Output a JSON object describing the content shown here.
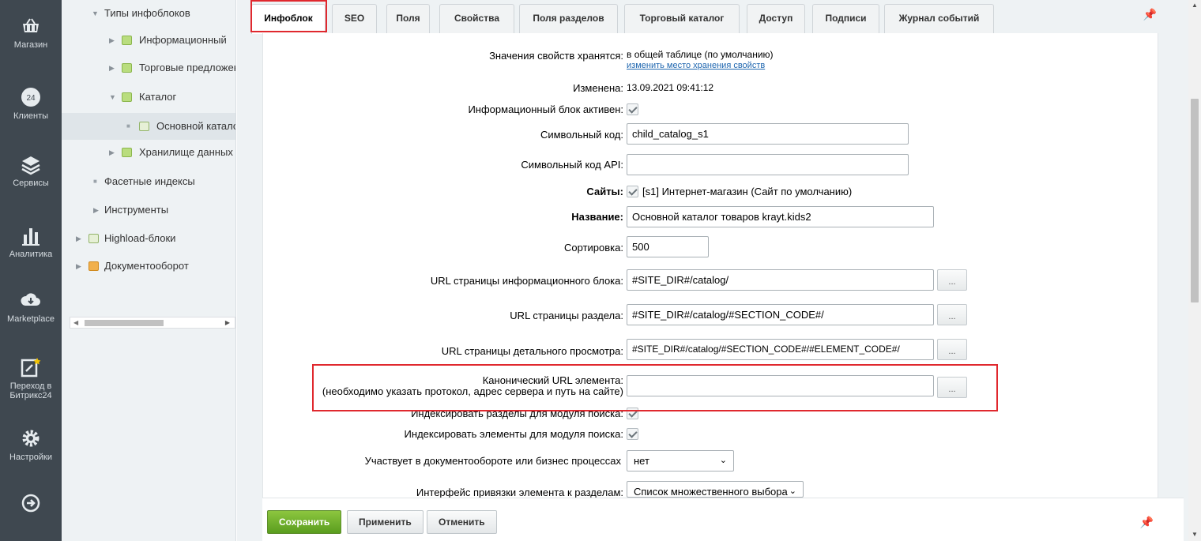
{
  "leftnav": {
    "items": [
      {
        "label": "Магазин",
        "icon": "basket-icon"
      },
      {
        "label": "Клиенты",
        "icon": "crm-24-icon"
      },
      {
        "label": "Сервисы",
        "icon": "layers-icon"
      },
      {
        "label": "Аналитика",
        "icon": "bar-chart-icon"
      },
      {
        "label": "Marketplace",
        "icon": "cloud-download-icon"
      },
      {
        "label": "Переход в Битрикс24",
        "icon": "star-edit-icon"
      },
      {
        "label": "Настройки",
        "icon": "gear-icon"
      }
    ],
    "bottom_icon": "arrow-circle-icon"
  },
  "tree": {
    "items": [
      {
        "label": "Типы инфоблоков",
        "expanded": true
      },
      {
        "label": "Информационный"
      },
      {
        "label": "Торговые предложения"
      },
      {
        "label": "Каталог",
        "expanded": true
      },
      {
        "label": "Основной каталог"
      },
      {
        "label": "Хранилище данных"
      },
      {
        "label": "Фасетные индексы"
      },
      {
        "label": "Инструменты"
      },
      {
        "label": "Highload-блоки"
      },
      {
        "label": "Документооборот"
      }
    ]
  },
  "tabs": [
    "Инфоблок",
    "SEO",
    "Поля",
    "Свойства",
    "Поля разделов",
    "Торговый каталог",
    "Доступ",
    "Подписи",
    "Журнал событий"
  ],
  "form": {
    "storage_label": "Значения свойств хранятся:",
    "storage_value": "в общей таблице (по умолчанию)",
    "storage_link": "изменить место хранения свойств",
    "modified_label": "Изменена:",
    "modified_value": "13.09.2021 09:41:12",
    "active_label": "Информационный блок активен:",
    "code_label": "Символьный код:",
    "code_value": "child_catalog_s1",
    "api_code_label": "Символьный код API:",
    "api_code_value": "",
    "sites_label": "Сайты:",
    "sites_value": "[s1] Интернет-магазин (Сайт по умолчанию)",
    "name_label": "Название:",
    "name_value": "Основной каталог товаров krayt.kids2",
    "sort_label": "Сортировка:",
    "sort_value": "500",
    "list_url_label": "URL страницы информационного блока:",
    "list_url_value": "#SITE_DIR#/catalog/",
    "section_url_label": "URL страницы раздела:",
    "section_url_value": "#SITE_DIR#/catalog/#SECTION_CODE#/",
    "detail_url_label": "URL страницы детального просмотра:",
    "detail_url_value": "#SITE_DIR#/catalog/#SECTION_CODE#/#ELEMENT_CODE#/",
    "canonical_label_1": "Канонический URL элемента:",
    "canonical_label_2": "(необходимо указать протокол, адрес сервера и путь на сайте)",
    "canonical_value": "",
    "dots": "...",
    "index_sections_label": "Индексировать разделы для модуля поиска:",
    "index_elements_label": "Индексировать элементы для модуля поиска:",
    "workflow_label": "Участвует в документообороте или бизнес процессах",
    "workflow_value": "нет",
    "section_iface_label": "Интерфейс привязки элемента к разделам:",
    "section_iface_value": "Список множественного выбора"
  },
  "buttons": {
    "save": "Сохранить",
    "apply": "Применить",
    "cancel": "Отменить"
  },
  "colors": {
    "highlight": "#e0282e",
    "save_green": "#6aab2a",
    "nav_bg": "#3f4850"
  }
}
